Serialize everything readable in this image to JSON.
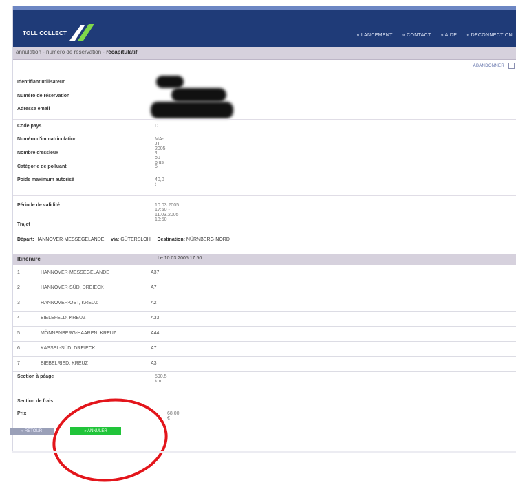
{
  "brand": {
    "logo_text": "TOLL COLLECT"
  },
  "nav": [
    "» LANCEMENT",
    "» CONTACT",
    "» AIDE",
    "» DECONNECTION"
  ],
  "breadcrumb": {
    "prefix": "annulation - numéro de reservation - ",
    "current": "récapitulatif"
  },
  "abandon_label": "ABANDONNER",
  "identity": {
    "user_label": "Identifiant utilisateur",
    "reservation_label": "Numéro de réservation",
    "email_label": "Adresse email"
  },
  "vehicle": [
    {
      "label": "Code pays",
      "value": "D"
    },
    {
      "label": "Numéro d'immatriculation",
      "value": "MA-JT 2005"
    },
    {
      "label": "Nombre d'essieux",
      "value": "4 ou plus"
    },
    {
      "label": "Catégorie de polluant",
      "value": "5"
    },
    {
      "label": "Poids maximum autorisé",
      "value": "40,0 t"
    }
  ],
  "validity": {
    "label": "Période de validité",
    "value": "10.03.2005 17:50 - 11.03.2005 18:50"
  },
  "trajet": {
    "label": "Trajet",
    "depart_label": "Départ:",
    "depart": "HANNOVER-MESSEGELÄNDE",
    "via_label": "via:",
    "via": "GÜTERSLOH",
    "dest_label": "Destination:",
    "dest": "NÜRNBERG-NORD"
  },
  "itinerary": {
    "title": "Itinéraire",
    "date": "Le 10.03.2005 17:50",
    "rows": [
      {
        "n": "1",
        "place": "HANNOVER-MESSEGELÄNDE",
        "road": "A37"
      },
      {
        "n": "2",
        "place": "HANNOVER-SÜD, DREIECK",
        "road": "A7"
      },
      {
        "n": "3",
        "place": "HANNOVER-OST, KREUZ",
        "road": "A2"
      },
      {
        "n": "4",
        "place": "BIELEFELD, KREUZ",
        "road": "A33"
      },
      {
        "n": "5",
        "place": "MÖNNENBERG-HAAREN, KREUZ",
        "road": "A44"
      },
      {
        "n": "6",
        "place": "KASSEL-SÜD, DREIECK",
        "road": "A7"
      },
      {
        "n": "7",
        "place": "BIEBELRIED, KREUZ",
        "road": "A3"
      }
    ]
  },
  "toll": {
    "label": "Section à péage",
    "value": "590,5 km"
  },
  "fees": {
    "label": "Section de frais"
  },
  "price": {
    "label": "Prix",
    "value": "68,00 €"
  },
  "buttons": {
    "back": "« RETOUR",
    "cancel": "» ANNULER"
  },
  "colors": {
    "header": "#1f3b78",
    "accent_green": "#21c43a",
    "annotation_red": "#e3151b"
  }
}
